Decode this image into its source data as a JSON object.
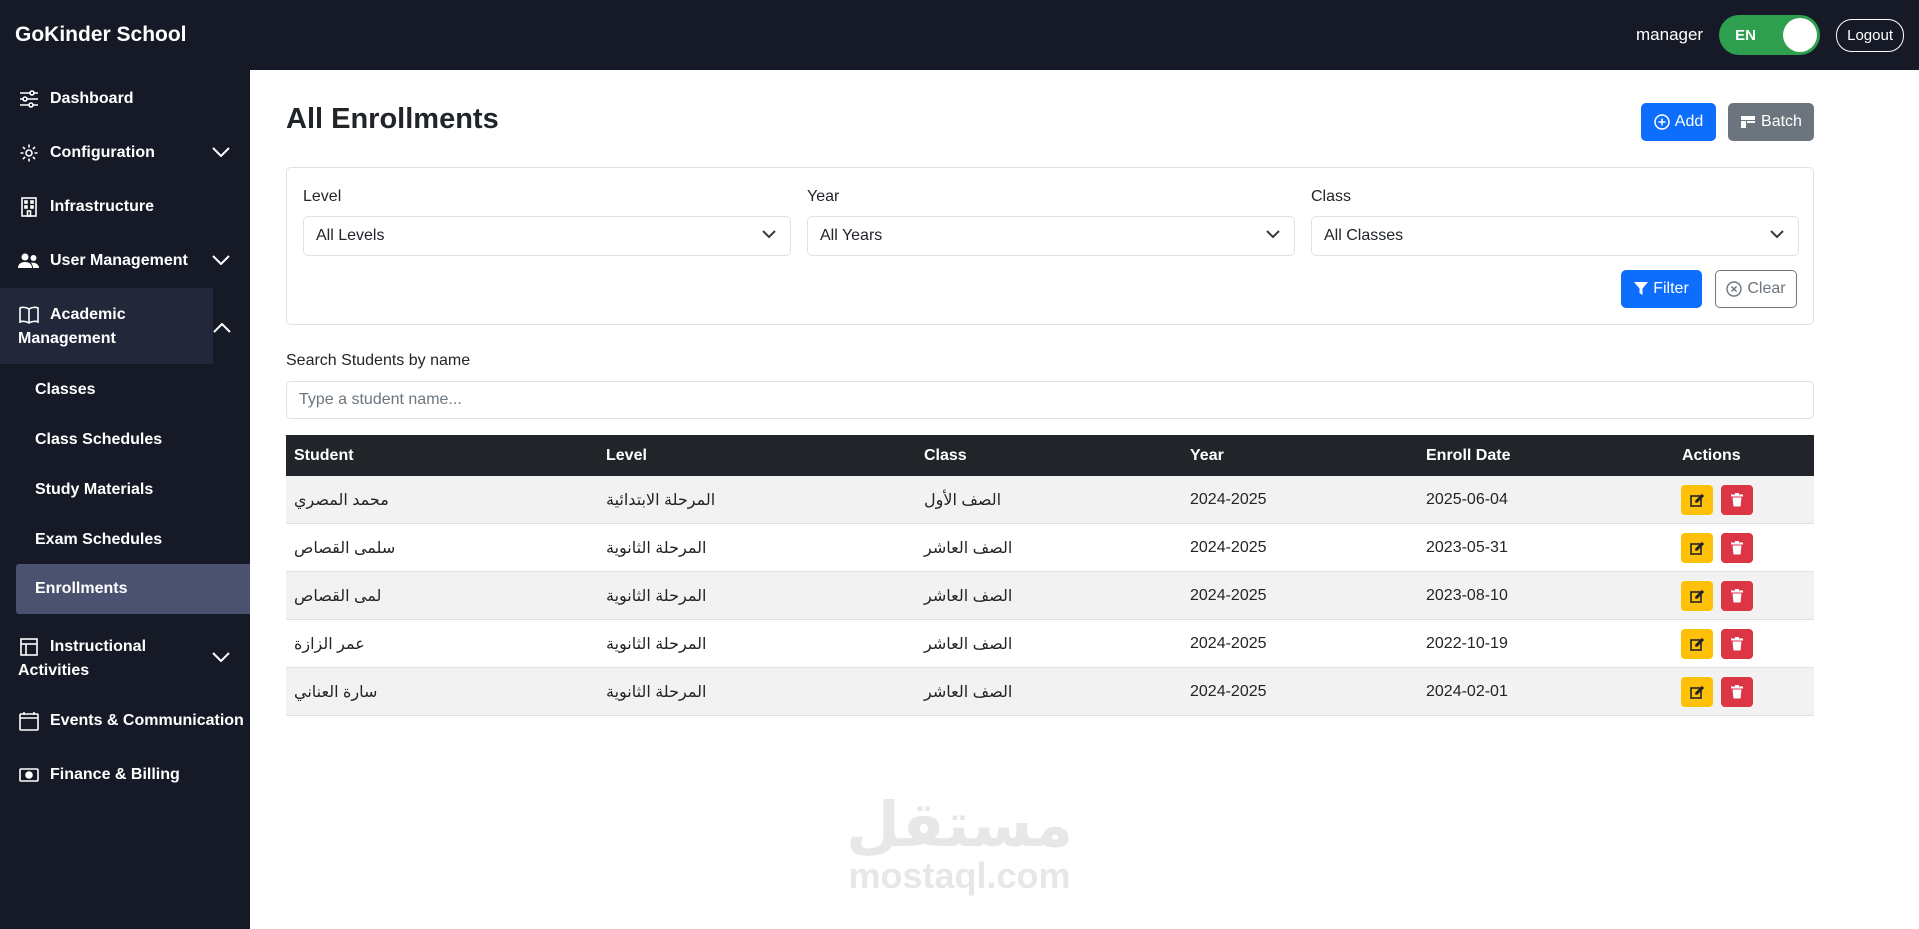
{
  "app": {
    "brand": "GoKinder School",
    "user": "manager",
    "language": "EN",
    "logout": "Logout"
  },
  "sidebar": {
    "items": [
      {
        "label": "Dashboard",
        "icon": "sliders-icon"
      },
      {
        "label": "Configuration",
        "icon": "gear-icon",
        "expandable": true
      },
      {
        "label": "Infrastructure",
        "icon": "building-icon"
      },
      {
        "label": "User Management",
        "icon": "users-icon",
        "expandable": true
      },
      {
        "label": "Academic Management",
        "line1": "Academic",
        "line2": "Management",
        "icon": "book-icon",
        "expanded": true
      },
      {
        "label": "Instructional Activities",
        "line1": "Instructional",
        "line2": "Activities",
        "icon": "grid-icon",
        "expandable": true
      },
      {
        "label": "Events & Communication",
        "icon": "calendar-icon"
      },
      {
        "label": "Finance & Billing",
        "icon": "cash-icon"
      }
    ],
    "sub_items": [
      "Classes",
      "Class Schedules",
      "Study Materials",
      "Exam Schedules",
      "Enrollments"
    ],
    "active_sub": "Enrollments"
  },
  "main": {
    "title": "All Enrollments",
    "add_label": "Add",
    "batch_label": "Batch",
    "filters": {
      "level_label": "Level",
      "level_value": "All Levels",
      "year_label": "Year",
      "year_value": "All Years",
      "class_label": "Class",
      "class_value": "All Classes",
      "filter_label": "Filter",
      "clear_label": "Clear"
    },
    "search": {
      "label": "Search Students by name",
      "placeholder": "Type a student name..."
    },
    "table": {
      "headers": [
        "Student",
        "Level",
        "Class",
        "Year",
        "Enroll Date",
        "Actions"
      ],
      "rows": [
        [
          "محمد المصري",
          "المرحلة الابتدائية",
          "الصف الأول",
          "2024-2025",
          "2025-06-04"
        ],
        [
          "سلمى القصاص",
          "المرحلة الثانوية",
          "الصف العاشر",
          "2024-2025",
          "2023-05-31"
        ],
        [
          "لمى القصاص",
          "المرحلة الثانوية",
          "الصف العاشر",
          "2024-2025",
          "2023-08-10"
        ],
        [
          "عمر الزازة",
          "المرحلة الثانوية",
          "الصف العاشر",
          "2024-2025",
          "2022-10-19"
        ],
        [
          "سارة العناني",
          "المرحلة الثانوية",
          "الصف العاشر",
          "2024-2025",
          "2024-02-01"
        ]
      ]
    }
  },
  "watermark": {
    "arabic": "مستقل",
    "latin": "mostaql.com"
  },
  "colors": {
    "primary": "#0d6efd",
    "secondary": "#6c757d",
    "warning": "#ffc107",
    "danger": "#dc3545",
    "sidebar": "#161a26",
    "toggle": "#2e9e4f"
  }
}
